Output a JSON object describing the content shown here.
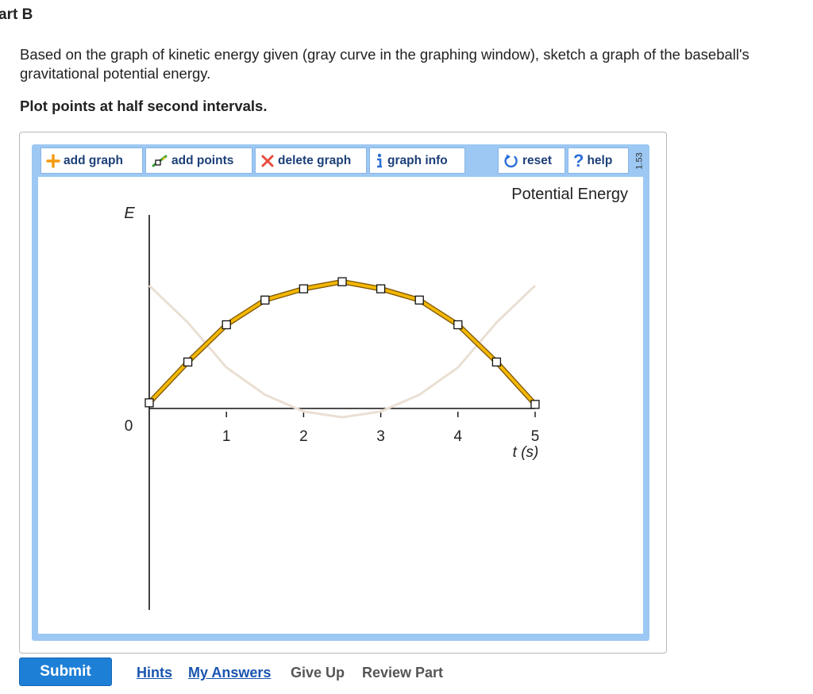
{
  "part_title": "art B",
  "question": "Based on the graph of kinetic energy given (gray curve in the graphing window), sketch a graph of the baseball's gravitational potential energy.",
  "instruction": "Plot points at half second intervals.",
  "toolbar": {
    "add_graph": "add graph",
    "add_points": "add points",
    "delete_graph": "delete graph",
    "graph_info": "graph info",
    "reset": "reset",
    "help": "help",
    "version": "1.53",
    "colors": {
      "plus": "#f39c12",
      "delete": "#e74c3c",
      "info": "#2b6fd6",
      "reset": "#2b6fd6",
      "help": "#2b6fd6",
      "pencil": "#3aa23a"
    }
  },
  "graph": {
    "title": "Potential Energy",
    "y_axis_label": "E",
    "x_axis_label": "t (s)",
    "origin_label": "0"
  },
  "chart_data": {
    "type": "line",
    "title": "Potential Energy",
    "xlabel": "t (s)",
    "ylabel": "E",
    "xlim": [
      0,
      5
    ],
    "ylim": [
      -6,
      6.3
    ],
    "x_ticks": [
      "1",
      "2",
      "3",
      "4",
      "5"
    ],
    "series": [
      {
        "style": "reference",
        "color": "#eadfd3",
        "x": [
          0,
          0.5,
          1,
          1.5,
          2,
          2.5,
          3,
          3.5,
          4,
          4.5,
          5
        ],
        "y": [
          4.1,
          2.95,
          1.55,
          0.7,
          0.18,
          0.0,
          0.18,
          0.7,
          1.55,
          2.95,
          4.1
        ]
      },
      {
        "style": "answer",
        "color": "#f2b705",
        "x": [
          0,
          0.5,
          1,
          1.5,
          2,
          2.5,
          3,
          3.5,
          4,
          4.5,
          5
        ],
        "y": [
          0.45,
          1.72,
          2.88,
          3.65,
          4.0,
          4.22,
          4.0,
          3.65,
          2.88,
          1.72,
          0.4
        ]
      }
    ]
  },
  "actions": {
    "submit": "Submit",
    "hints": "Hints",
    "my_answers": "My Answers",
    "give_up": "Give Up",
    "review_part": "Review Part"
  }
}
